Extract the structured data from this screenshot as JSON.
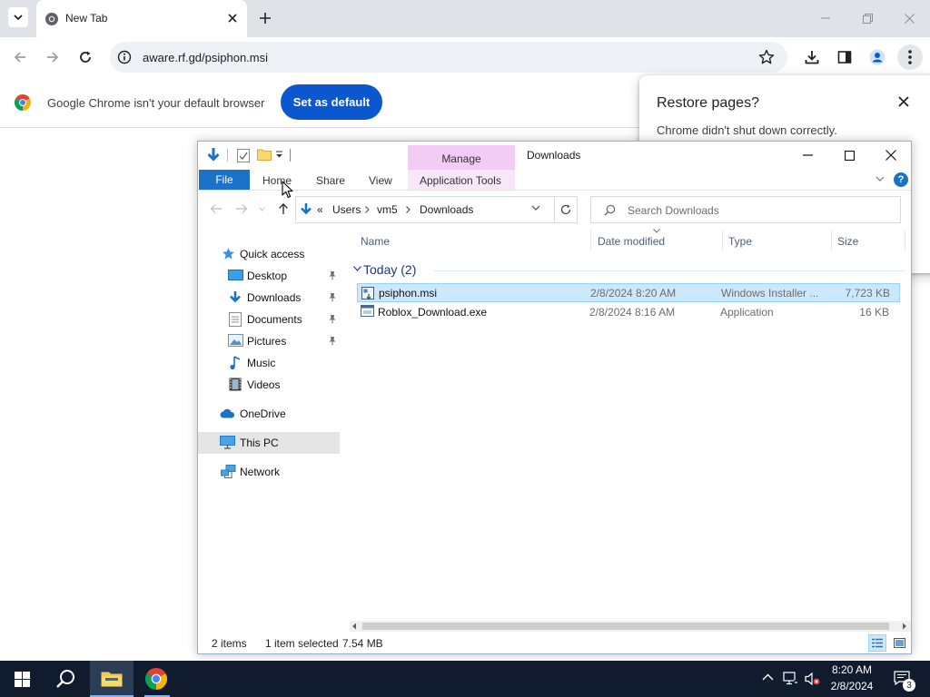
{
  "chrome": {
    "tab_title": "New Tab",
    "url": "aware.rf.gd/psiphon.msi",
    "infobar_text": "Google Chrome isn't your default browser",
    "set_default_label": "Set as default",
    "restore_title": "Restore pages?",
    "restore_message": "Chrome didn't shut down correctly.",
    "accent_color": "#0b57d0"
  },
  "explorer": {
    "window_title": "Downloads",
    "context_tab_group": "Manage",
    "ribbon_tabs": [
      "File",
      "Home",
      "Share",
      "View",
      "Application Tools"
    ],
    "breadcrumb": [
      "Users",
      "vm5",
      "Downloads"
    ],
    "breadcrumb_prefix": "«",
    "search_placeholder": "Search Downloads",
    "nav": {
      "quick_access": "Quick access",
      "desktop": "Desktop",
      "downloads": "Downloads",
      "documents": "Documents",
      "pictures": "Pictures",
      "music": "Music",
      "videos": "Videos",
      "onedrive": "OneDrive",
      "this_pc": "This PC",
      "network": "Network"
    },
    "columns": [
      "Name",
      "Date modified",
      "Type",
      "Size"
    ],
    "group_label": "Today (2)",
    "files": [
      {
        "name": "psiphon.msi",
        "date": "2/8/2024 8:20 AM",
        "type": "Windows Installer ...",
        "size": "7,723 KB",
        "selected": true,
        "icon": "msi-icon"
      },
      {
        "name": "Roblox_Download.exe",
        "date": "2/8/2024 8:16 AM",
        "type": "Application",
        "size": "16 KB",
        "selected": false,
        "icon": "exe-icon"
      }
    ],
    "status": {
      "items": "2 items",
      "selected": "1 item selected",
      "size": "7.54 MB"
    }
  },
  "taskbar": {
    "time": "8:20 AM",
    "date": "2/8/2024",
    "notification_count": "3"
  }
}
